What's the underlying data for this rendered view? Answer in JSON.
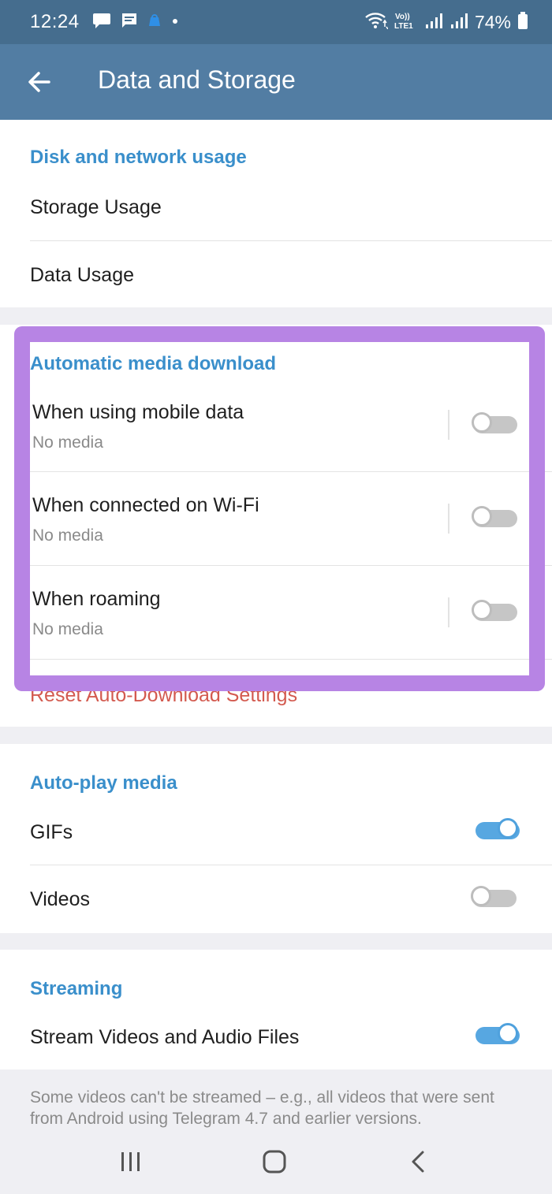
{
  "status_bar": {
    "time": "12:24",
    "notification_icons": [
      "chat-bubble-icon",
      "message-icon",
      "app-icon",
      "dot-icon"
    ],
    "right_icons": [
      "wifi-icon",
      "volte-lte-icon",
      "signal-icon",
      "signal-icon-2"
    ],
    "volte_label": "Vo)) LTE1",
    "battery_text": "74%",
    "battery_level": 0.74
  },
  "app_bar": {
    "back_icon": "arrow-left-icon",
    "title": "Data and Storage"
  },
  "disk_section": {
    "header": "Disk and network usage",
    "items": [
      {
        "label": "Storage Usage"
      },
      {
        "label": "Data Usage"
      }
    ]
  },
  "auto_download": {
    "header": "Automatic media download",
    "items": [
      {
        "title": "When using mobile data",
        "subtitle": "No media",
        "enabled": false
      },
      {
        "title": "When connected on Wi-Fi",
        "subtitle": "No media",
        "enabled": false
      },
      {
        "title": "When roaming",
        "subtitle": "No media",
        "enabled": false
      }
    ],
    "reset_label": "Reset Auto-Download Settings"
  },
  "autoplay": {
    "header": "Auto-play media",
    "items": [
      {
        "label": "GIFs",
        "enabled": true
      },
      {
        "label": "Videos",
        "enabled": false
      }
    ]
  },
  "streaming": {
    "header": "Streaming",
    "item": {
      "label": "Stream Videos and Audio Files",
      "enabled": true
    },
    "note": "Some videos can't be streamed – e.g., all videos that were sent from Android using Telegram 4.7 and earlier versions."
  },
  "nav_bar": {
    "buttons": [
      "recent-apps-icon",
      "home-icon",
      "back-icon"
    ]
  },
  "colors": {
    "status_bar": "#456d8e",
    "app_bar": "#527da3",
    "accent": "#3a8fcb",
    "toggle_on": "#57a7e1",
    "reset_text": "#d35a4f",
    "highlight": "#b784e4"
  }
}
